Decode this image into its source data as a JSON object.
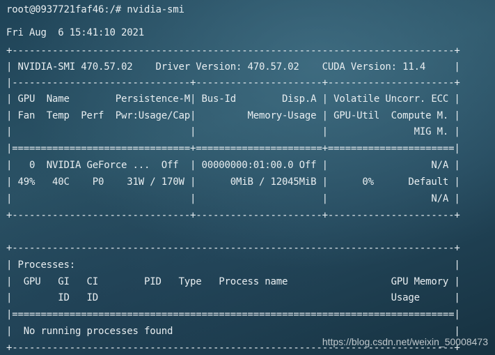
{
  "terminal": {
    "prompt_line": "root@0937721faf46:/# nvidia-smi",
    "timestamp": "Fri Aug  6 15:41:10 2021",
    "gpu_table": [
      "+-----------------------------------------------------------------------------+",
      "| NVIDIA-SMI 470.57.02    Driver Version: 470.57.02    CUDA Version: 11.4     |",
      "|-------------------------------+----------------------+----------------------+",
      "| GPU  Name        Persistence-M| Bus-Id        Disp.A | Volatile Uncorr. ECC |",
      "| Fan  Temp  Perf  Pwr:Usage/Cap|         Memory-Usage | GPU-Util  Compute M. |",
      "|                               |                      |               MIG M. |",
      "|===============================+======================+======================|",
      "|   0  NVIDIA GeForce ...  Off  | 00000000:01:00.0 Off |                  N/A |",
      "| 49%   40C    P0    31W / 170W |      0MiB / 12045MiB |      0%      Default |",
      "|                               |                      |                  N/A |",
      "+-------------------------------+----------------------+----------------------+"
    ],
    "processes_table": [
      "+-----------------------------------------------------------------------------+",
      "| Processes:                                                                  |",
      "|  GPU   GI   CI        PID   Type   Process name                  GPU Memory |",
      "|        ID   ID                                                   Usage      |",
      "|=============================================================================|",
      "|  No running processes found                                                 |",
      "+-----------------------------------------------------------------------------+"
    ]
  },
  "watermark": "https://blog.csdn.net/weixin_50008473"
}
